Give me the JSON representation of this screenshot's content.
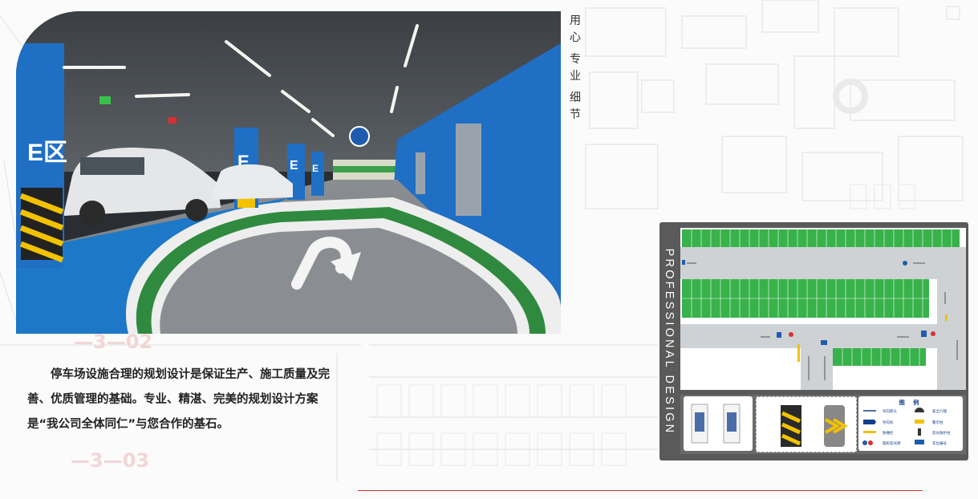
{
  "tagline": [
    "用",
    "心",
    "专",
    "业",
    "细",
    "节"
  ],
  "intro_text": "停车场设施合理的规划设计是保证生产、施工质量及完善、优质管理的基础。专业、精湛、完美的规划设计方案是“我公司全体同仁”与您合作的基石。",
  "photo": {
    "zone_sign": "E区",
    "pillar_letter": "E"
  },
  "side_label": "PROFESSIONAL DESIGN",
  "legend": {
    "title": "图 例",
    "items": [
      "导向箭头",
      "安全凸镜",
      "导向标",
      "警示柱",
      "防撞栏",
      "反光防护柱",
      "圆形反光牌",
      "车位编号"
    ]
  },
  "background_plan": {
    "labels": [
      "—3—02",
      "—3—03"
    ]
  },
  "colors": {
    "wall_blue": "#1f6fc4",
    "floor_green": "#2e9a3e",
    "card_gray": "#5a5a5a",
    "accent_red": "#cc3333",
    "legend_blue": "#123d8a"
  }
}
